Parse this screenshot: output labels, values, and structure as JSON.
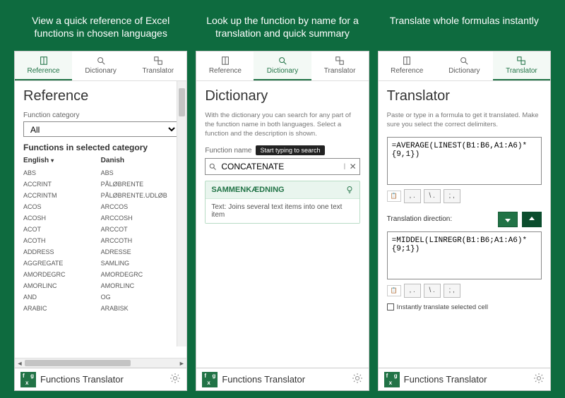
{
  "captions": {
    "reference": "View a quick reference of Excel functions in chosen languages",
    "dictionary": "Look up the function by name for a translation and quick summary",
    "translator": "Translate whole formulas instantly"
  },
  "tabs": {
    "reference": "Reference",
    "dictionary": "Dictionary",
    "translator": "Translator"
  },
  "footer": {
    "app_name": "Functions Translator"
  },
  "reference": {
    "title": "Reference",
    "category_label": "Function category",
    "category_value": "All",
    "subhead": "Functions in selected category",
    "col1": "English",
    "col2": "Danish",
    "rows": [
      {
        "a": "ABS",
        "b": "ABS"
      },
      {
        "a": "ACCRINT",
        "b": "PÅLØBRENTE"
      },
      {
        "a": "ACCRINTM",
        "b": "PÅLØBRENTE.UDLØB"
      },
      {
        "a": "ACOS",
        "b": "ARCCOS"
      },
      {
        "a": "ACOSH",
        "b": "ARCCOSH"
      },
      {
        "a": "ACOT",
        "b": "ARCCOT"
      },
      {
        "a": "ACOTH",
        "b": "ARCCOTH"
      },
      {
        "a": "ADDRESS",
        "b": "ADRESSE"
      },
      {
        "a": "AGGREGATE",
        "b": "SAMLING"
      },
      {
        "a": "AMORDEGRC",
        "b": "AMORDEGRC"
      },
      {
        "a": "AMORLINC",
        "b": "AMORLINC"
      },
      {
        "a": "AND",
        "b": "OG"
      },
      {
        "a": "ARABIC",
        "b": "ARABISK"
      }
    ]
  },
  "dictionary": {
    "title": "Dictionary",
    "desc": "With the dictionary you can search for any part of the function name in both languages. Select a function and the description is shown.",
    "fn_label": "Function name",
    "tooltip": "Start typing to search",
    "search_value": "CONCATENATE",
    "result_name": "SAMMENKÆDNING",
    "result_desc": "Text: Joins several text items into one text item"
  },
  "translator": {
    "title": "Translator",
    "desc": "Paste or type in a formula to get it translated. Make sure you select the correct delimiters.",
    "input_value": "=AVERAGE(LINEST(B1:B6,A1:A6)*{9,1})",
    "direction_label": "Translation direction:",
    "output_value": "=MIDDEL(LINREGR(B1:B6;A1:A6)*{9;1})",
    "instant_label": "Instantly translate selected cell",
    "delims": {
      "a": ", .",
      "b": "\\ .",
      "c": "; ,"
    }
  }
}
